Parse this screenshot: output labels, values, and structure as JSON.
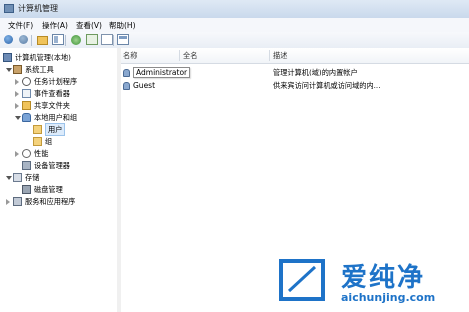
{
  "window": {
    "title": "计算机管理"
  },
  "menu": [
    {
      "label": "文件(F)"
    },
    {
      "label": "操作(A)"
    },
    {
      "label": "查看(V)"
    },
    {
      "label": "帮助(H)"
    }
  ],
  "tree": {
    "root": "计算机管理(本地)",
    "system_tools": "系统工具",
    "task_scheduler": "任务计划程序",
    "event_viewer": "事件查看器",
    "shared_folders": "共享文件夹",
    "local_users_groups": "本地用户和组",
    "users": "用户",
    "groups": "组",
    "performance": "性能",
    "device_manager": "设备管理器",
    "storage": "存储",
    "disk_management": "磁盘管理",
    "services_apps": "服务和应用程序"
  },
  "list": {
    "columns": {
      "name": "名称",
      "fullname": "全名",
      "desc": "描述"
    },
    "rows": [
      {
        "name": "Administrator",
        "fullname": "",
        "desc": "管理计算机(域)的内置帐户"
      },
      {
        "name": "Guest",
        "fullname": "",
        "desc": "供来宾访问计算机或访问域的内..."
      }
    ]
  },
  "watermark": {
    "brand": "爱纯净",
    "url": "aichunjing.com"
  },
  "colors": {
    "accent": "#1e73c8",
    "selection": "#dcebfb"
  }
}
